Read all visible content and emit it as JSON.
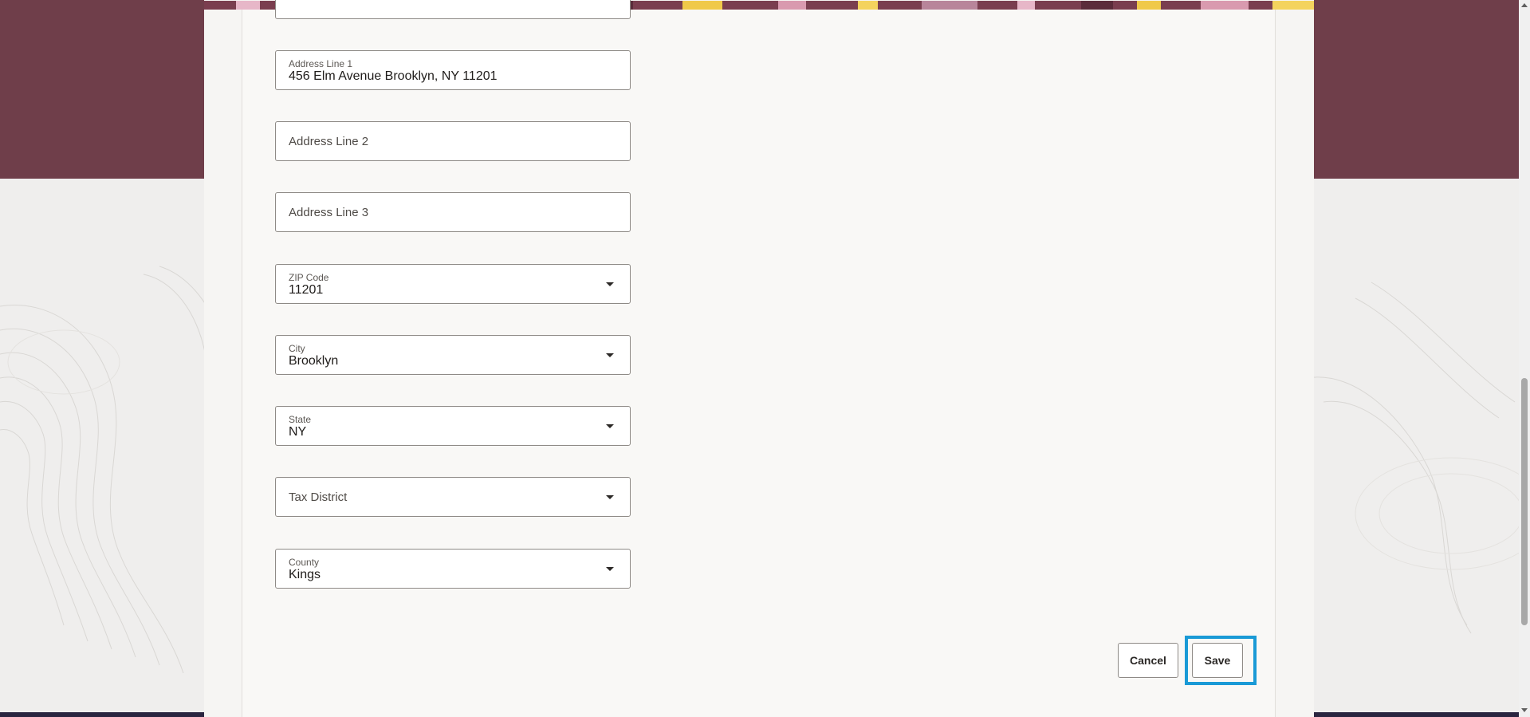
{
  "form": {
    "fields": [
      {
        "key": "address_line_1",
        "label": "Address Line 1",
        "value": "456 Elm Avenue Brooklyn, NY 11201",
        "type": "text"
      },
      {
        "key": "address_line_2",
        "label": "Address Line 2",
        "value": "",
        "type": "text"
      },
      {
        "key": "address_line_3",
        "label": "Address Line 3",
        "value": "",
        "type": "text"
      },
      {
        "key": "zip_code",
        "label": "ZIP Code",
        "value": "11201",
        "type": "select"
      },
      {
        "key": "city",
        "label": "City",
        "value": "Brooklyn",
        "type": "select"
      },
      {
        "key": "state",
        "label": "State",
        "value": "NY",
        "type": "select"
      },
      {
        "key": "tax_district",
        "label": "Tax District",
        "value": "",
        "type": "select"
      },
      {
        "key": "county",
        "label": "County",
        "value": "Kings",
        "type": "select"
      }
    ]
  },
  "actions": {
    "cancel_label": "Cancel",
    "save_label": "Save"
  },
  "colors": {
    "header_band": "#6f3e4a",
    "focus_ring": "#1a9ad6",
    "field_border": "#8e8a86",
    "panel_background": "#f9f8f6"
  },
  "icons": {
    "dropdown": "chevron-down-icon"
  }
}
